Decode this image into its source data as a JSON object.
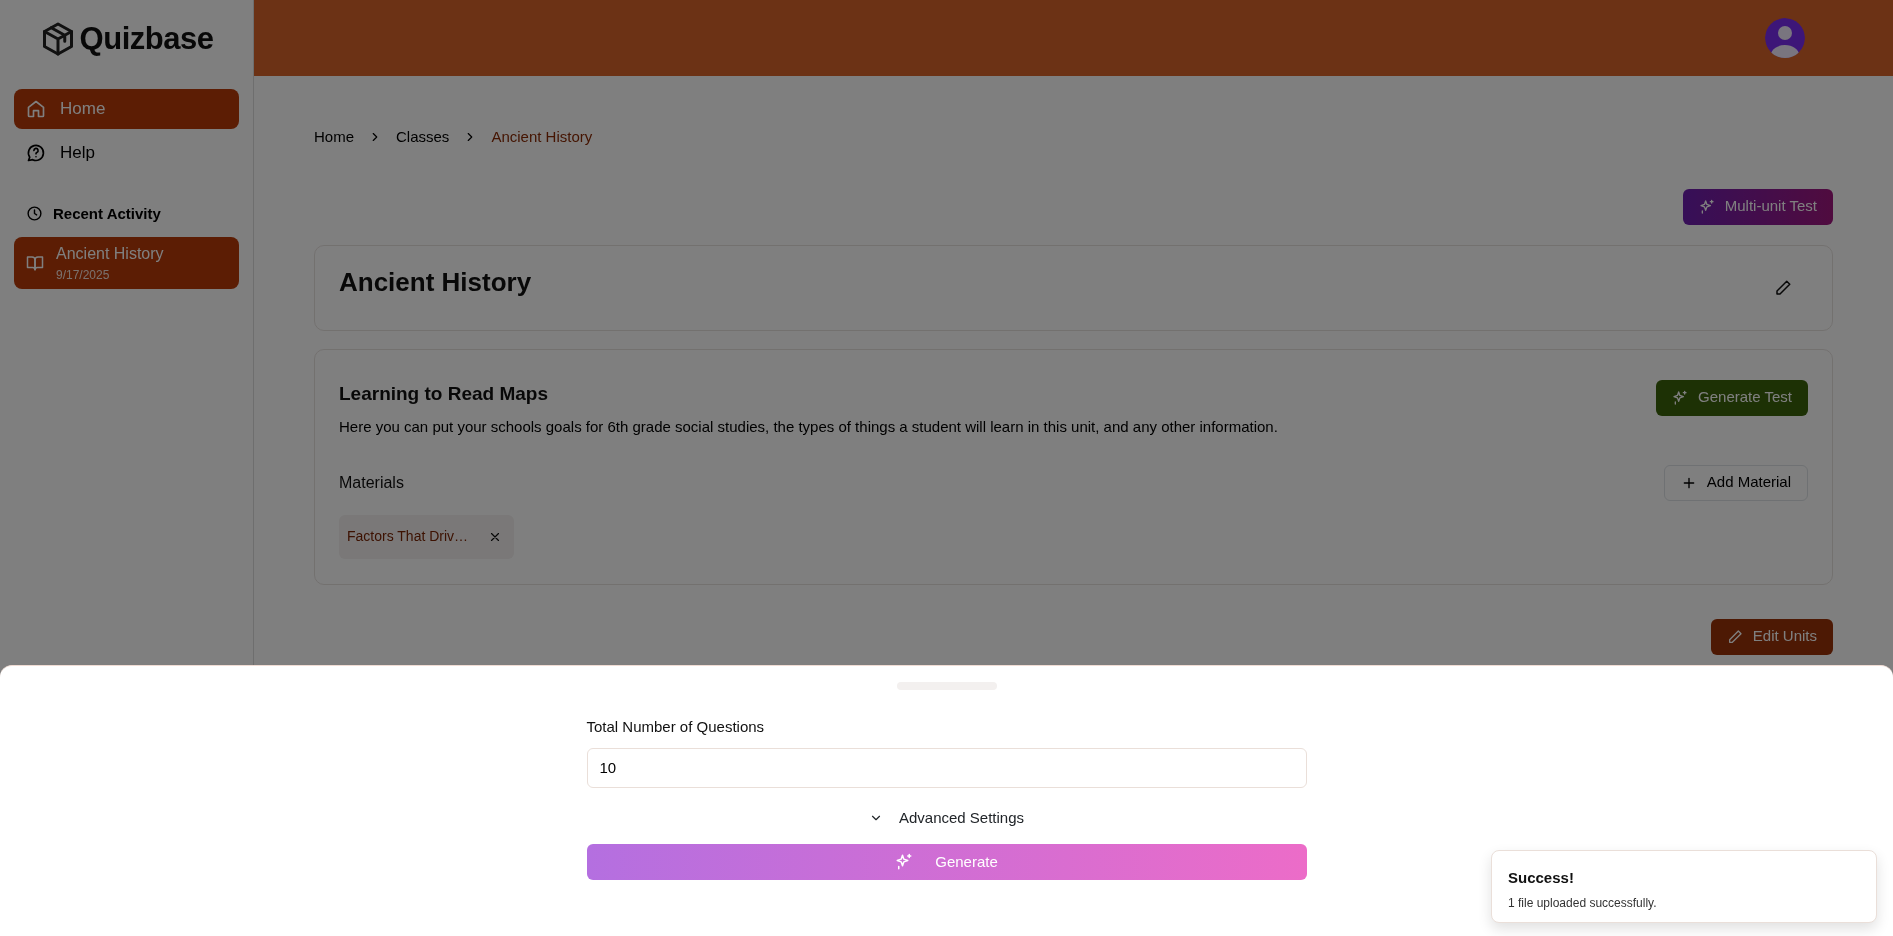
{
  "sidebar": {
    "logo": "Quizbase",
    "nav": [
      {
        "label": "Home",
        "selected": true
      },
      {
        "label": "Help",
        "selected": false
      }
    ],
    "recent_title": "Recent Activity",
    "recent": [
      {
        "title": "Ancient History",
        "date": "9/17/2025",
        "selected": true
      }
    ]
  },
  "breadcrumb": [
    {
      "label": "Home",
      "current": false
    },
    {
      "label": "Classes",
      "current": false
    },
    {
      "label": "Ancient History",
      "current": true
    }
  ],
  "multi_unit_button": "Multi-unit Test",
  "class_title": "Ancient History",
  "unit": {
    "title": "Learning to Read Maps",
    "description": "Here you can put your schools goals for 6th grade social studies, the types of things a student will learn in this unit, and any other information.",
    "generate_button": "Generate Test",
    "materials_label": "Materials",
    "add_button": "Add Material",
    "materials": [
      {
        "name": "Factors That Driv…"
      }
    ]
  },
  "edit_units_button": "Edit Units",
  "drawer": {
    "field_label": "Total Number of Questions",
    "field_value": "10",
    "advanced": "Advanced Settings",
    "expanded": false,
    "generate": "Generate"
  },
  "toast": {
    "title": "Success!",
    "message": "1 file uploaded successfully."
  }
}
